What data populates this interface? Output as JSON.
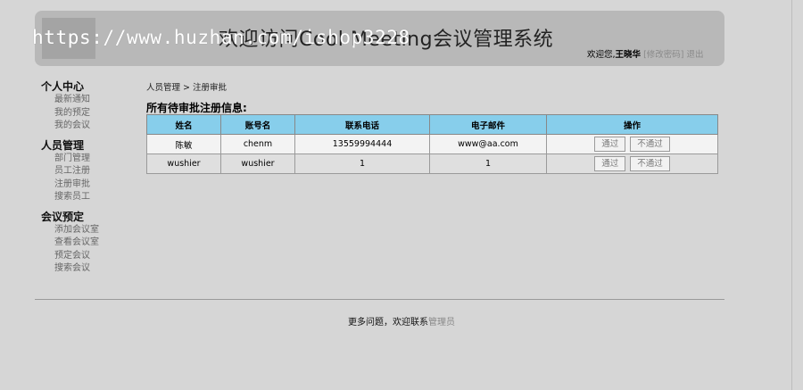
{
  "header": {
    "title": "欢迎访问Cool Meeting会议管理系统",
    "watermark": "https://www.huzhan.com/ishop3228",
    "welcome_prefix": "欢迎您,",
    "user_name": "王晓华",
    "change_password": "[修改密码]",
    "logout": "退出"
  },
  "sidebar": {
    "groups": [
      {
        "title": "个人中心",
        "items": [
          "最新通知",
          "我的预定",
          "我的会议"
        ]
      },
      {
        "title": "人员管理",
        "items": [
          "部门管理",
          "员工注册",
          "注册审批",
          "搜索员工"
        ]
      },
      {
        "title": "会议预定",
        "items": [
          "添加会议室",
          "查看会议室",
          "预定会议",
          "搜索会议"
        ]
      }
    ]
  },
  "main": {
    "breadcrumb": "人员管理 > 注册审批",
    "section_title": "所有待审批注册信息:",
    "table": {
      "headers": [
        "姓名",
        "账号名",
        "联系电话",
        "电子邮件",
        "操作"
      ],
      "rows": [
        {
          "name": "陈敏",
          "account": "chenm",
          "phone": "13559994444",
          "email": "www@aa.com",
          "approve": "通过",
          "reject": "不通过"
        },
        {
          "name": "wushier",
          "account": "wushier",
          "phone": "1",
          "email": "1",
          "approve": "通过",
          "reject": "不通过"
        }
      ]
    }
  },
  "footer": {
    "text": "更多问题，欢迎联系",
    "admin_link": "管理员"
  }
}
